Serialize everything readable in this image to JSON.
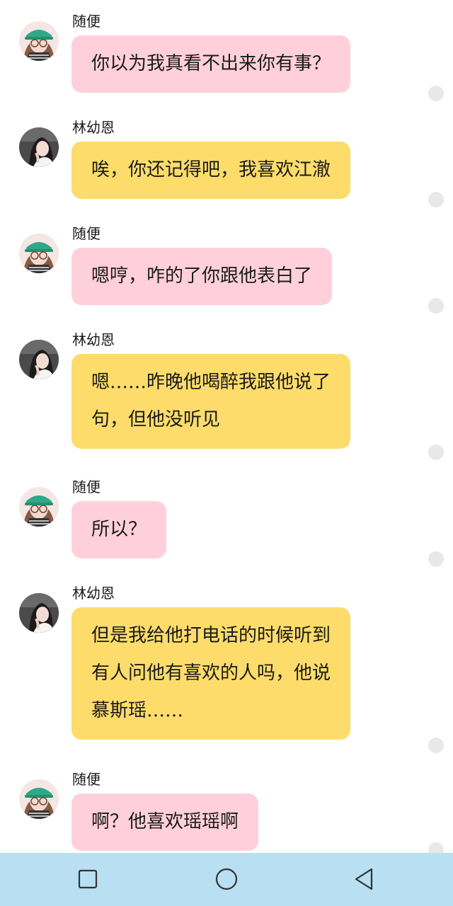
{
  "messages": [
    {
      "sender": "随便",
      "avatar": "girl-avatar-icon",
      "lines": [
        "你以为我真看不出来你有事？"
      ]
    },
    {
      "sender": "林幼恩",
      "avatar": "dark-haired-girl-avatar-icon",
      "lines": [
        "唉，你还记得吧，我喜欢江澈"
      ]
    },
    {
      "sender": "随便",
      "avatar": "girl-avatar-icon",
      "lines": [
        "嗯哼，咋的了你跟他表白了"
      ]
    },
    {
      "sender": "林幼恩",
      "avatar": "dark-haired-girl-avatar-icon",
      "lines": [
        "嗯……昨晚他喝醉我跟他说了",
        "句，但他没听见"
      ]
    },
    {
      "sender": "随便",
      "avatar": "girl-avatar-icon",
      "lines": [
        "所以？"
      ]
    },
    {
      "sender": "林幼恩",
      "avatar": "dark-haired-girl-avatar-icon",
      "lines": [
        "但是我给他打电话的时候听到",
        "有人问他有喜欢的人吗，他说",
        "慕斯瑶……"
      ]
    },
    {
      "sender": "随便",
      "avatar": "girl-avatar-icon",
      "lines": [
        "啊？他喜欢瑶瑶啊"
      ]
    }
  ],
  "navbar": {
    "buttons": [
      "recent-apps-icon",
      "home-icon",
      "back-icon"
    ]
  },
  "colors": {
    "pink_bubble": "#ffd0dc",
    "yellow_bubble": "#fddc6b",
    "navbar": "#b9dff2"
  }
}
